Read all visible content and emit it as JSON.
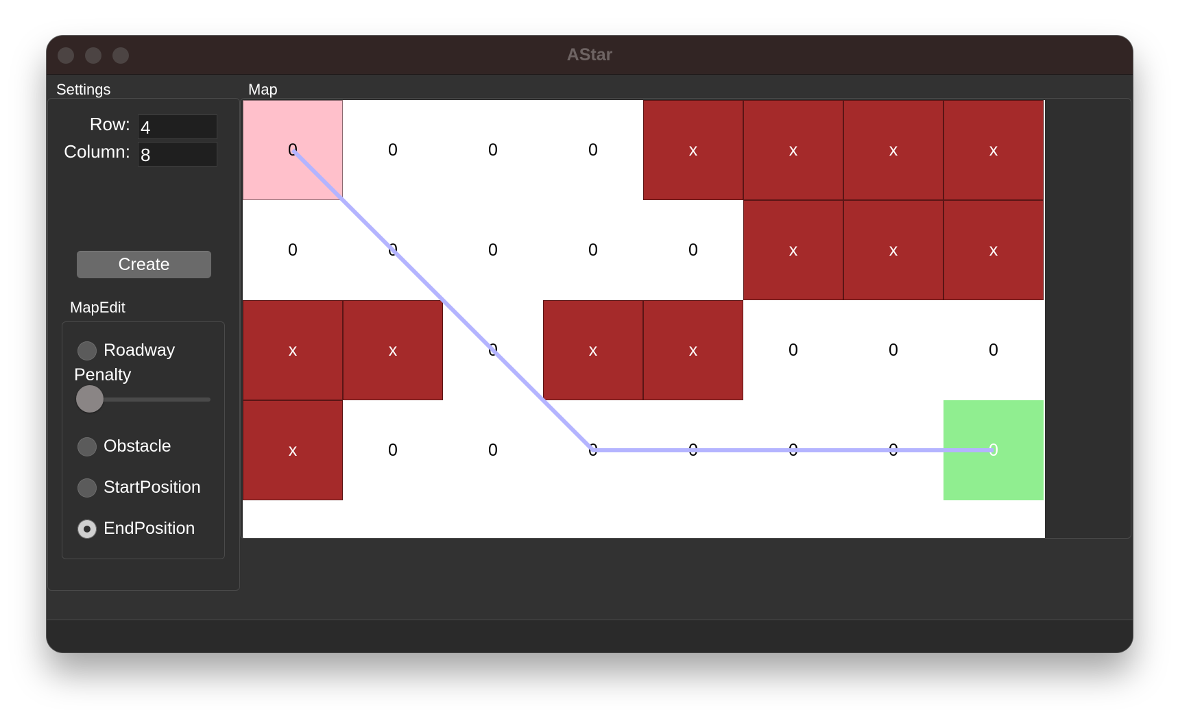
{
  "window": {
    "title": "AStar"
  },
  "settings": {
    "group_label": "Settings",
    "row_label": "Row:",
    "row_value": "4",
    "column_label": "Column:",
    "column_value": "8",
    "create_label": "Create",
    "mapedit": {
      "group_label": "MapEdit",
      "roadway_label": "Roadway",
      "penalty_label": "Penalty",
      "penalty_value": 0,
      "obstacle_label": "Obstacle",
      "start_label": "StartPosition",
      "end_label": "EndPosition",
      "selected": "EndPosition"
    }
  },
  "map": {
    "group_label": "Map",
    "cells": [
      [
        "0",
        "0",
        "0",
        "0",
        "x",
        "x",
        "x",
        "x"
      ],
      [
        "0",
        "0",
        "0",
        "0",
        "0",
        "x",
        "x",
        "x"
      ],
      [
        "x",
        "x",
        "0",
        "x",
        "x",
        "0",
        "0",
        "0"
      ],
      [
        "x",
        "0",
        "0",
        "0",
        "0",
        "0",
        "0",
        "0"
      ]
    ],
    "start": [
      0,
      0
    ],
    "end": [
      3,
      7
    ],
    "path": [
      [
        0,
        0
      ],
      [
        1,
        1
      ],
      [
        2,
        2
      ],
      [
        3,
        3
      ],
      [
        3,
        4
      ],
      [
        3,
        5
      ],
      [
        3,
        6
      ],
      [
        3,
        7
      ]
    ],
    "colors": {
      "obstacle": "#a52a2a",
      "start": "#ffc0cb",
      "end": "#90ee90",
      "path": "#b4b4ff"
    }
  }
}
